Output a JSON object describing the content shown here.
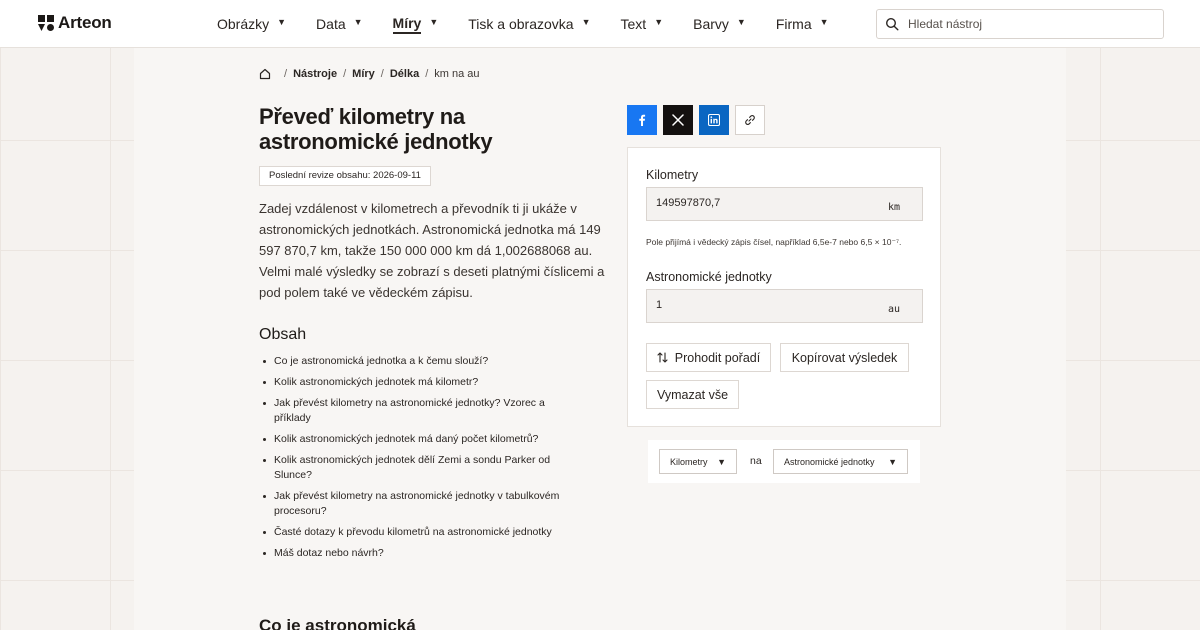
{
  "header": {
    "logo_text": "Arteon",
    "nav": [
      {
        "label": "Obrázky",
        "active": false
      },
      {
        "label": "Data",
        "active": false
      },
      {
        "label": "Míry",
        "active": true
      },
      {
        "label": "Tisk a obrazovka",
        "active": false
      },
      {
        "label": "Text",
        "active": false
      },
      {
        "label": "Barvy",
        "active": false
      },
      {
        "label": "Firma",
        "active": false
      }
    ],
    "search_placeholder": "Hledat nástroj"
  },
  "breadcrumb": [
    "Nástroje",
    "Míry",
    "Délka",
    "km na au"
  ],
  "page_title": "Převeď kilometry na astronomické jednotky",
  "revision": "Poslední revize obsahu: 2026-09-11",
  "intro": "Zadej vzdálenost v kilometrech a převodník ti ji ukáže v astronomických jednotkách. Astronomická jednotka má 149 597 870,7 km, takže 150 000 000 km dá 1,002688068 au. Velmi malé výsledky se zobrazí s deseti platnými číslicemi a pod polem také ve vědeckém zápisu.",
  "toc": {
    "title": "Obsah",
    "items": [
      "Co je astronomická jednotka a k čemu slouží?",
      "Kolik astronomických jednotek má kilometr?",
      "Jak převést kilometry na astronomické jednotky? Vzorec a příklady",
      "Kolik astronomických jednotek má daný počet kilometrů?",
      "Kolik astronomických jednotek dělí Zemi a sondu Parker od Slunce?",
      "Jak převést kilometry na astronomické jednotky v tabulkovém procesoru?",
      "Časté dotazy k převodu kilometrů na astronomické jednotky",
      "Máš dotaz nebo návrh?"
    ]
  },
  "section_heading": "Co je astronomická",
  "share": {
    "icons": [
      "facebook-icon",
      "x-icon",
      "linkedin-icon",
      "link-icon"
    ]
  },
  "converter": {
    "from_label": "Kilometry",
    "from_value": "149597870,7",
    "from_unit": "km",
    "hint": "Pole přijímá i vědecký zápis čísel, například 6,5e-7 nebo 6,5 × 10⁻⁷.",
    "to_label": "Astronomické jednotky",
    "to_value": "1",
    "to_unit": "au",
    "swap_label": "Prohodit pořadí",
    "copy_label": "Kopírovat výsledek",
    "clear_label": "Vymazat vše"
  },
  "units": {
    "from": "Kilometry",
    "connector": "na",
    "to": "Astronomické jednotky"
  },
  "colors": {
    "facebook": "#1877f2",
    "x": "#141110",
    "linkedin": "#0a66c2",
    "background": "#f5f2ef"
  }
}
